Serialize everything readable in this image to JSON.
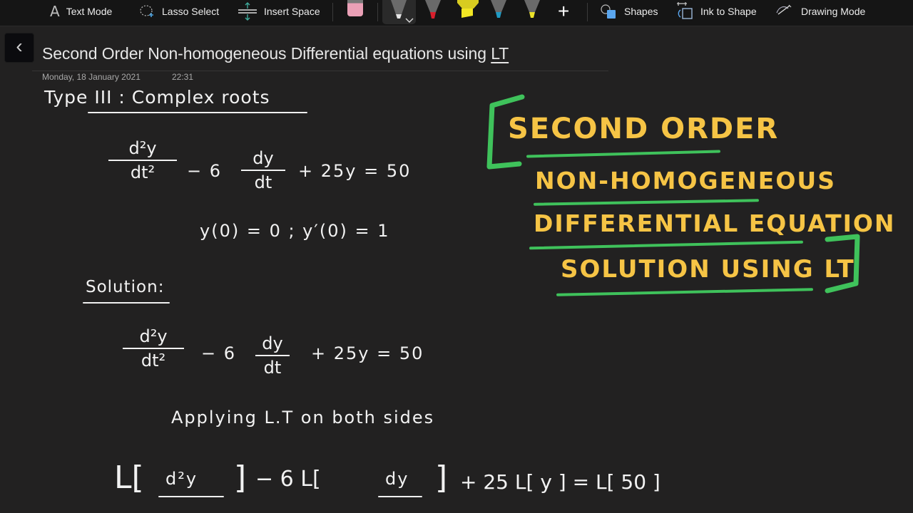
{
  "toolbar": {
    "text_mode": "Text Mode",
    "lasso_select": "Lasso Select",
    "insert_space": "Insert Space",
    "eraser": "eraser",
    "pens": [
      {
        "name": "white-pen",
        "color": "#e6e6e6",
        "selected": true
      },
      {
        "name": "red-pen",
        "color": "#d81f2c",
        "selected": false
      },
      {
        "name": "yellow-highlighter",
        "color": "#f3e724",
        "selected": false
      },
      {
        "name": "blue-pen",
        "color": "#1f9bc4",
        "selected": false
      },
      {
        "name": "yellow-pen",
        "color": "#ece32a",
        "selected": false
      }
    ],
    "add_pen": "+",
    "shapes": "Shapes",
    "ink_to_shape": "Ink to Shape",
    "drawing_mode": "Drawing Mode"
  },
  "page": {
    "back": "‹",
    "title_main": "Second Order Non-homogeneous Differential equations using ",
    "title_underlined": "LT",
    "date": "Monday, 18 January 2021",
    "time": "22:31"
  },
  "ink": {
    "heading": "Type III : Complex roots",
    "eq1": {
      "num1": "d²y",
      "den1": "dt²",
      "mid": "− 6",
      "num2": "dy",
      "den2": "dt",
      "rhs": "+ 25y = 50"
    },
    "initial_conditions": "y(0) = 0  ;  y′(0) = 1",
    "solution_label": "Solution:",
    "eq2": {
      "num1": "d²y",
      "den1": "dt²",
      "mid": "− 6",
      "num2": "dy",
      "den2": "dt",
      "rhs": "+ 25y = 50"
    },
    "applying": "Applying L.T on both sides",
    "eq3": {
      "l1": "L[",
      "num1": "d²y",
      "close1": "]",
      "mid": "− 6  L[",
      "num2": "dy",
      "close2": "]",
      "rhs": "+ 25 L[ y ] = L[ 50 ]"
    }
  },
  "banner": {
    "line1": "Second Order",
    "line2": "Non-Homogeneous",
    "line3": "Differential Equation",
    "line4": "Solution Using LT",
    "text_color": "#f6c445",
    "accent_color": "#3fc25b"
  }
}
